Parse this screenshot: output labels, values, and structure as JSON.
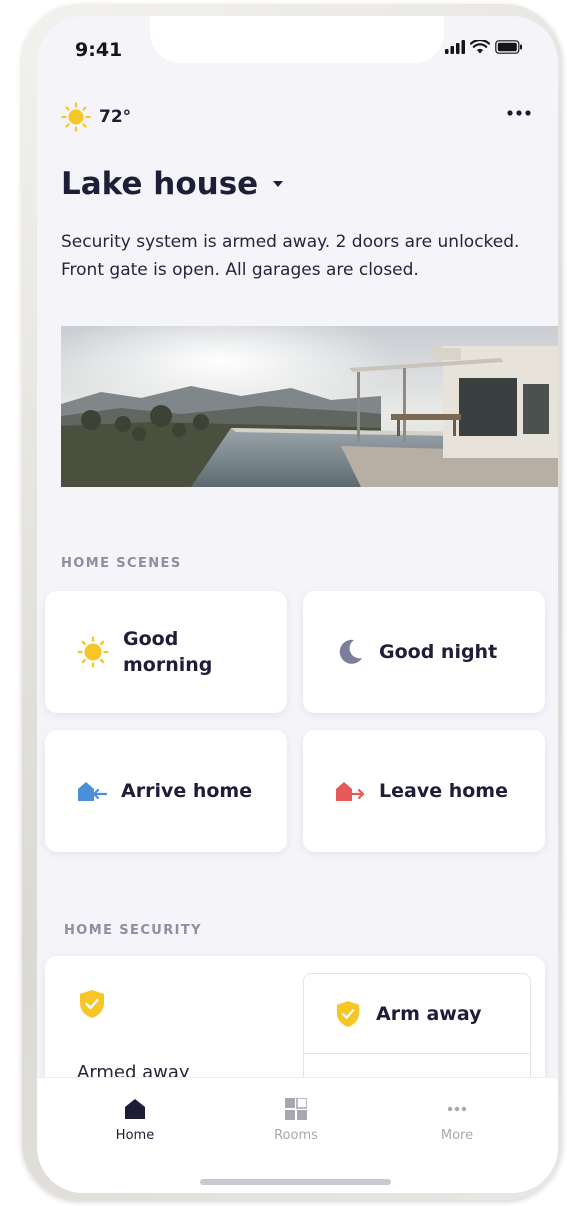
{
  "status_bar": {
    "time": "9:41"
  },
  "weather": {
    "temperature": "72°",
    "icon": "sun-icon"
  },
  "header": {
    "title": "Lake house"
  },
  "summary": "Security system is armed away. 2 doors are unlocked. Front gate is open. All garages are closed.",
  "home_scenes": {
    "label": "HOME SCENES",
    "items": [
      {
        "label": "Good morning",
        "icon": "sun-icon"
      },
      {
        "label": "Good night",
        "icon": "moon-icon"
      },
      {
        "label": "Arrive home",
        "icon": "arrive-home-icon"
      },
      {
        "label": "Leave home",
        "icon": "leave-home-icon"
      }
    ]
  },
  "home_security": {
    "label": "HOME SECURITY",
    "status": "Armed away",
    "action": "Arm away"
  },
  "tabs": [
    {
      "label": "Home",
      "active": true
    },
    {
      "label": "Rooms",
      "active": false
    },
    {
      "label": "More",
      "active": false
    }
  ],
  "colors": {
    "accent_yellow": "#f6c627",
    "navy": "#1e1e38",
    "arrive_blue": "#4a8fd9",
    "leave_red": "#e55a57"
  }
}
